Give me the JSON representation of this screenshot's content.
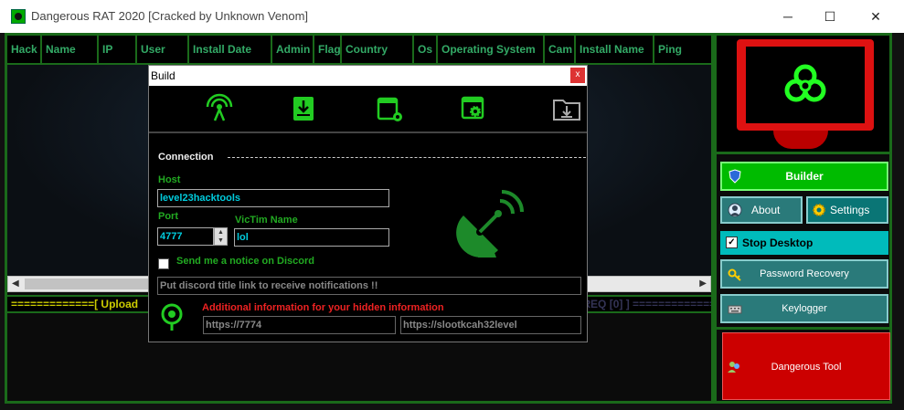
{
  "window": {
    "title": "Dangerous RAT 2020 [Cracked by Unknown Venom]",
    "min_glyph": "─",
    "max_glyph": "☐",
    "close_glyph": "✕"
  },
  "grid": {
    "columns": [
      "Hack",
      "Name",
      "IP",
      "User",
      "Install Date",
      "Admin",
      "Flag",
      "Country",
      "Os",
      "Operating System",
      "Cam",
      "Install Name",
      "Ping"
    ]
  },
  "status_strip": {
    "left": "=============[  Upload",
    "right": "Online [0]  Selected [0]  REQ [0]  ]  ============="
  },
  "sidebar": {
    "builder": "Builder",
    "about": "About",
    "settings": "Settings",
    "stop_desktop": "Stop Desktop",
    "stop_desktop_checked": true,
    "password_recovery": "Password Recovery",
    "keylogger": "Keylogger",
    "dangerous_tool": "Dangerous Tool"
  },
  "build_dialog": {
    "title": "Build",
    "close_glyph": "x",
    "toolbar_icons": [
      "connection-icon",
      "install-icon",
      "assembly-icon",
      "settings-icon",
      "build-folder-icon"
    ],
    "section": "Connection",
    "host_label": "Host",
    "host_value": "level23hacktools",
    "port_label": "Port",
    "port_value": "4777",
    "victim_label": "VicTim Name",
    "victim_value": "lol",
    "discord_label": "Send me a notice on Discord",
    "discord_checked": false,
    "discord_placeholder": "Put discord title link to receive notifications !!",
    "additional_info": "Additional information for your hidden information",
    "url1": "https://7774",
    "url2": "https://slootkcah32level"
  },
  "colors": {
    "accent_green": "#1a6a1a",
    "builder_green": "#00bb00",
    "teal": "#2a7a7a",
    "danger_red": "#cc0000"
  }
}
